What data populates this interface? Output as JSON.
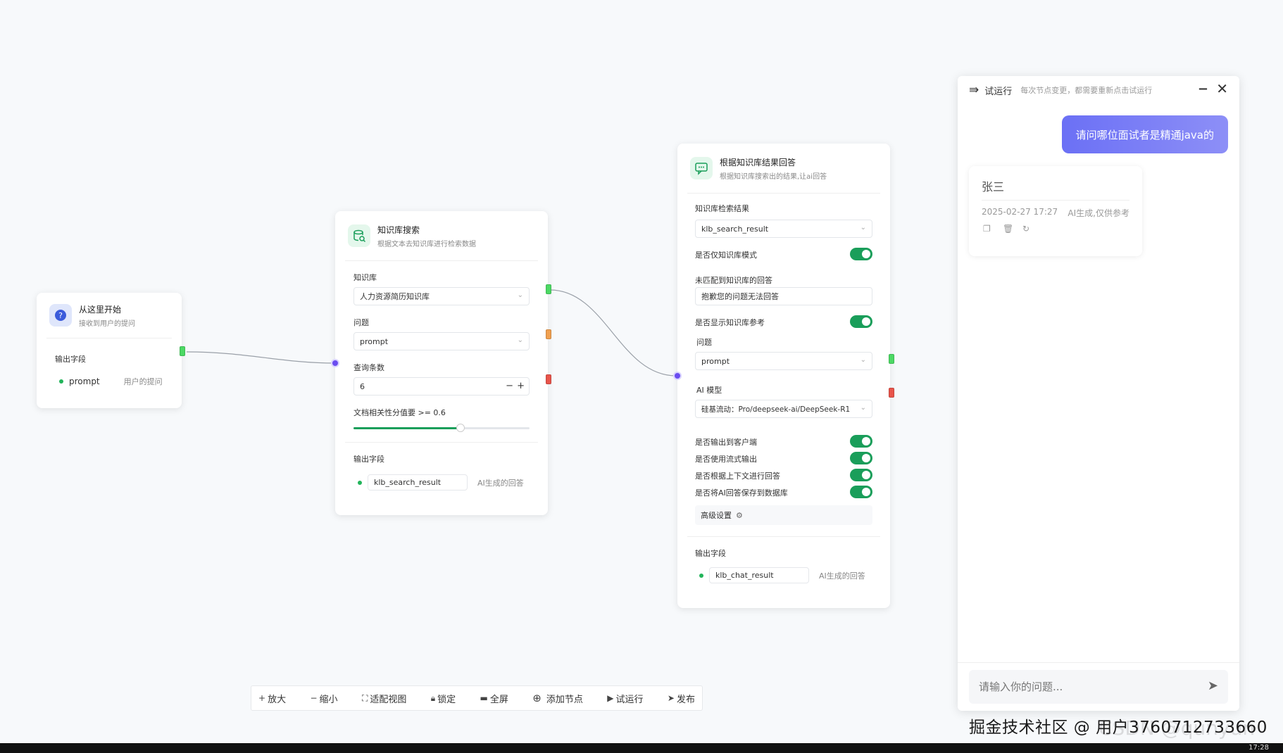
{
  "node_start": {
    "title": "从这里开始",
    "subtitle": "接收到用户的提问",
    "output_label": "输出字段",
    "output_name": "prompt",
    "output_desc": "用户的提问"
  },
  "node_search": {
    "title": "知识库搜索",
    "subtitle": "根据文本去知识库进行检索数据",
    "kb_label": "知识库",
    "kb_value": "人力资源简历知识库",
    "question_label": "问题",
    "question_value": "prompt",
    "count_label": "查询条数",
    "count_value": "6",
    "minus": "−",
    "plus": "+",
    "threshold_label": "文档相关性分值要 >= 0.6",
    "threshold_fraction": 0.6,
    "output_label": "输出字段",
    "output_name": "klb_search_result",
    "output_desc": "AI生成的回答"
  },
  "node_answer": {
    "title": "根据知识库结果回答",
    "subtitle": "根据知识库搜索出的结果,让ai回答",
    "result_label": "知识库检索结果",
    "result_value": "klb_search_result",
    "kb_only_label": "是否仅知识库模式",
    "unmatched_label": "未匹配到知识库的回答",
    "unmatched_value": "抱歉您的问题无法回答",
    "show_ref_label": "是否显示知识库参考",
    "question_label": "问题",
    "question_value": "prompt",
    "model_label": "AI 模型",
    "model_value": "硅基流动：Pro/deepseek-ai/DeepSeek-R1",
    "toggles": [
      "是否输出到客户端",
      "是否使用流式输出",
      "是否根据上下文进行回答",
      "是否将AI回答保存到数据库"
    ],
    "advanced_label": "高级设置",
    "output_label": "输出字段",
    "output_name": "klb_chat_result",
    "output_desc": "AI生成的回答"
  },
  "toolbar": {
    "zoom_in": "放大",
    "zoom_out": "缩小",
    "fit": "适配视图",
    "lock": "锁定",
    "fullscreen": "全屏",
    "add_node": "添加节点",
    "test_run": "试运行",
    "publish": "发布"
  },
  "panel": {
    "title": "试运行",
    "hint": "每次节点变更，都需要重新点击试运行",
    "user_message": "请问哪位面试者是精通java的",
    "ai_answer": "张三",
    "timestamp": "2025-02-27 17:27",
    "ai_note": "AI生成,仅供参考",
    "input_placeholder": "请输入你的问题..."
  },
  "watermark": "掘金技术社区 @ 用户3760712733660",
  "watermark_faint": "CSDN @qunyun",
  "clock": "17:28",
  "colors": {
    "accent": "#1a9e5a",
    "port_green": "#4cd964",
    "port_orange": "#f0a050",
    "port_red": "#e8544a",
    "connector": "#6a4cf0",
    "user_bubble": "#6b70f5"
  }
}
